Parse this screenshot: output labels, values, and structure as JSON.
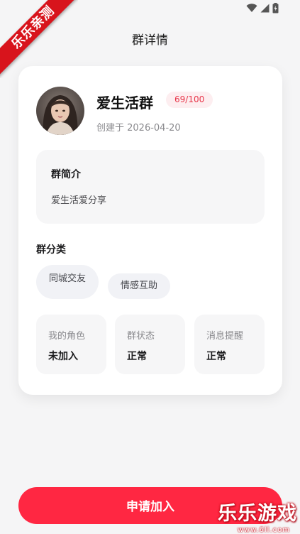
{
  "watermark": {
    "ribbon": "乐乐亲测",
    "brand": "乐乐游戏",
    "url": "www.6ll.com"
  },
  "header": {
    "title": "群详情"
  },
  "group": {
    "name": "爱生活群",
    "member_count": "69/100",
    "created": "创建于 2026-04-20"
  },
  "intro": {
    "title": "群简介",
    "text": "爱生活爱分享"
  },
  "categories": {
    "title": "群分类",
    "tags": [
      "同城交友",
      "情感互助"
    ]
  },
  "info": [
    {
      "label": "我的角色",
      "value": "未加入"
    },
    {
      "label": "群状态",
      "value": "正常"
    },
    {
      "label": "消息提醒",
      "value": "正常"
    }
  ],
  "actions": {
    "apply_label": "申请加入"
  },
  "colors": {
    "accent": "#ff2742",
    "badge_bg": "#fdeef0",
    "badge_text": "#e8364a",
    "page_bg": "#f5f5f6"
  }
}
